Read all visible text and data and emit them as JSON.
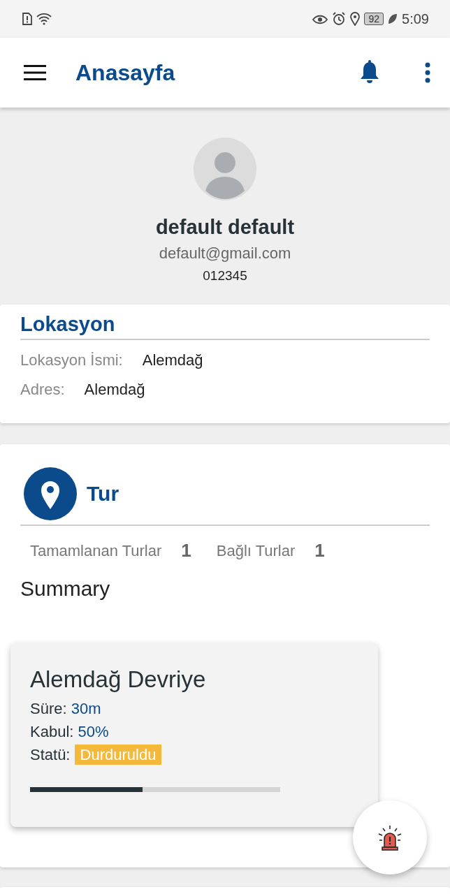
{
  "status_bar": {
    "battery": "92",
    "time": "5:09"
  },
  "app_bar": {
    "title": "Anasayfa"
  },
  "profile": {
    "name": "default default",
    "email": "default@gmail.com",
    "phone": "012345"
  },
  "location": {
    "title": "Lokasyon",
    "fields": [
      {
        "label": "Lokasyon İsmi:",
        "value": "Alemdağ"
      },
      {
        "label": "Adres:",
        "value": "Alemdağ"
      }
    ]
  },
  "tour": {
    "title": "Tur",
    "stats": [
      {
        "label": "Tamamlanan Turlar",
        "value": "1"
      },
      {
        "label": "Bağlı Turlar",
        "value": "1"
      }
    ],
    "summary_title": "Summary",
    "cards": [
      {
        "name": "Alemdağ Devriye",
        "duration_label": "Süre:",
        "duration": "30m",
        "acceptance_label": "Kabul:",
        "acceptance": "50%",
        "status_label": "Statü:",
        "status": "Durduruldu",
        "color": "#f4b83a",
        "level": 0.45
      }
    ]
  }
}
